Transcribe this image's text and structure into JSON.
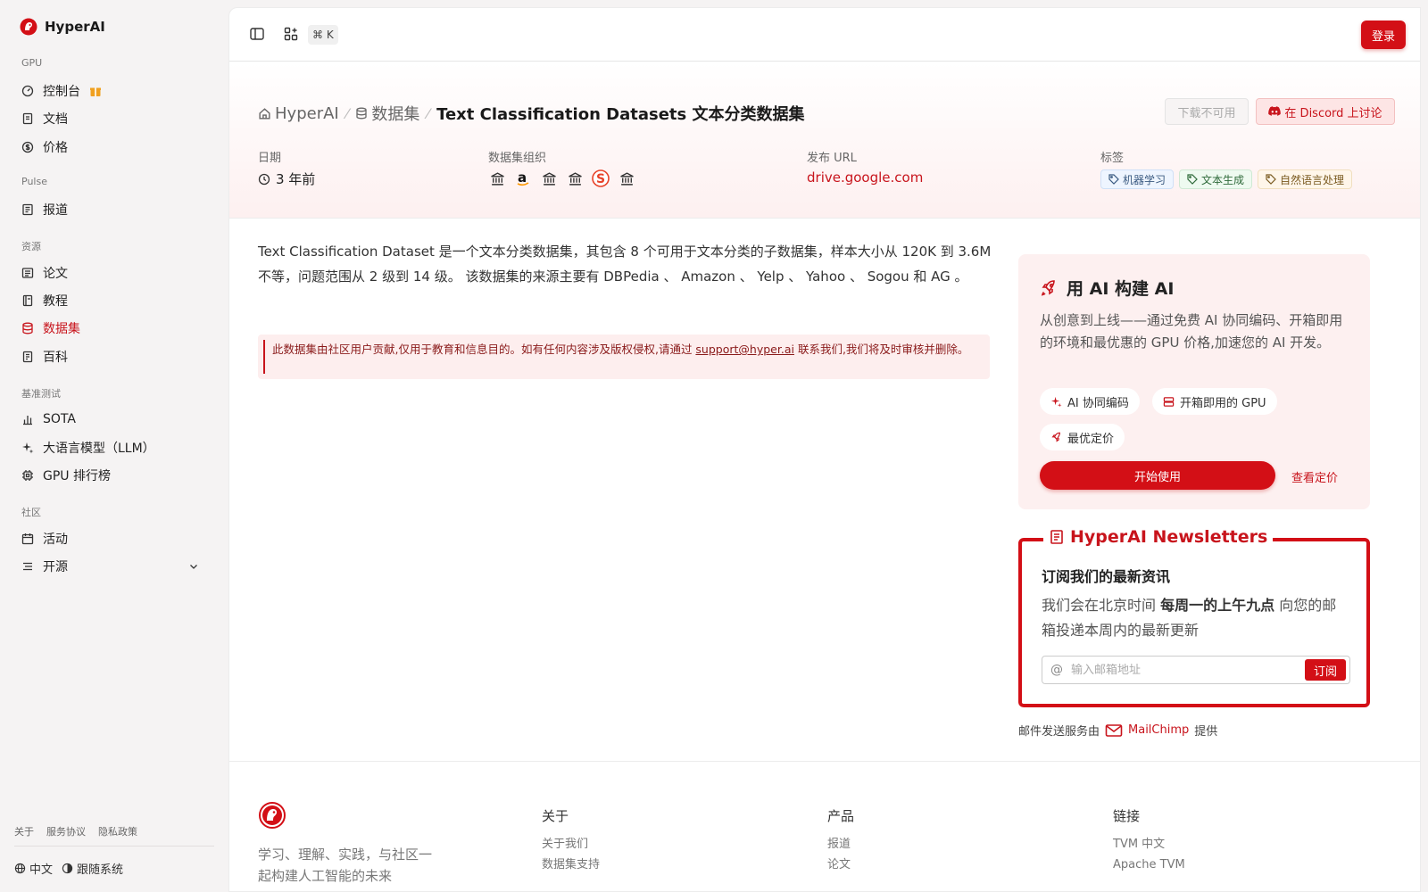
{
  "brand": {
    "name": "HyperAI",
    "color": "#d30f16"
  },
  "sidebar": {
    "sections": {
      "gpu": "GPU",
      "pulse": "Pulse",
      "resources": "资源",
      "benchmarks": "基准测试",
      "community": "社区"
    },
    "items": {
      "console": "控制台",
      "docs": "文档",
      "pricing": "价格",
      "news": "报道",
      "papers": "论文",
      "tutorials": "教程",
      "datasets": "数据集",
      "wiki": "百科",
      "sota": "SOTA",
      "llm": "大语言模型（LLM）",
      "gpu_leaderboard": "GPU 排行榜",
      "events": "活动",
      "open_source": "开源"
    },
    "footer_links": [
      "关于",
      "服务协议",
      "隐私政策"
    ],
    "language": "中文",
    "theme": "跟随系统"
  },
  "topbar": {
    "shortcut": "⌘ K",
    "login": "登录"
  },
  "breadcrumb": {
    "home": "HyperAI",
    "section": "数据集",
    "current": "Text Classification Datasets 文本分类数据集"
  },
  "actions": {
    "download": "下载不可用",
    "discord": "在 Discord 上讨论"
  },
  "meta": {
    "date_label": "日期",
    "date_value": "3 年前",
    "org_label": "数据集组织",
    "url_label": "发布 URL",
    "url_value": "drive.google.com",
    "tags_label": "标签",
    "tags": [
      "机器学习",
      "文本生成",
      "自然语言处理"
    ]
  },
  "description": "Text Classification Dataset 是一个文本分类数据集，其包含 8 个可用于文本分类的子数据集，样本大小从 120K 到 3.6M 不等，问题范围从 2 级到 14 级。 该数据集的来源主要有 DBPedia 、 Amazon 、 Yelp 、 Yahoo 、 Sogou 和 AG 。",
  "notice": {
    "text_before": "此数据集由社区用户贡献,仅用于教育和信息目的。如有任何内容涉及版权侵权,请通过 ",
    "email": "support@hyper.ai",
    "text_after": " 联系我们,我们将及时审核并删除。"
  },
  "promo": {
    "title": "用 AI 构建 AI",
    "desc": "从创意到上线——通过免费 AI 协同编码、开箱即用的环境和最优惠的 GPU 价格,加速您的 AI 开发。",
    "chips": [
      "AI 协同编码",
      "开箱即用的 GPU",
      "最优定价"
    ],
    "start": "开始使用",
    "pricing": "查看定价"
  },
  "newsletter": {
    "title": "HyperAI Newsletters",
    "heading": "订阅我们的最新资讯",
    "desc_before": "我们会在北京时间 ",
    "desc_bold": "每周一的上午九点",
    "desc_after": " 向您的邮箱投递本周内的最新更新",
    "placeholder": "输入邮箱地址",
    "subscribe": "订阅",
    "provider_before": "邮件发送服务由",
    "provider": "MailChimp",
    "provider_after": "提供"
  },
  "footer": {
    "tagline": "学习、理解、实践，与社区一起构建人工智能的未来",
    "columns": [
      {
        "title": "关于",
        "links": [
          "关于我们",
          "数据集支持"
        ]
      },
      {
        "title": "产品",
        "links": [
          "报道",
          "论文"
        ]
      },
      {
        "title": "链接",
        "links": [
          "TVM 中文",
          "Apache TVM"
        ]
      }
    ]
  }
}
